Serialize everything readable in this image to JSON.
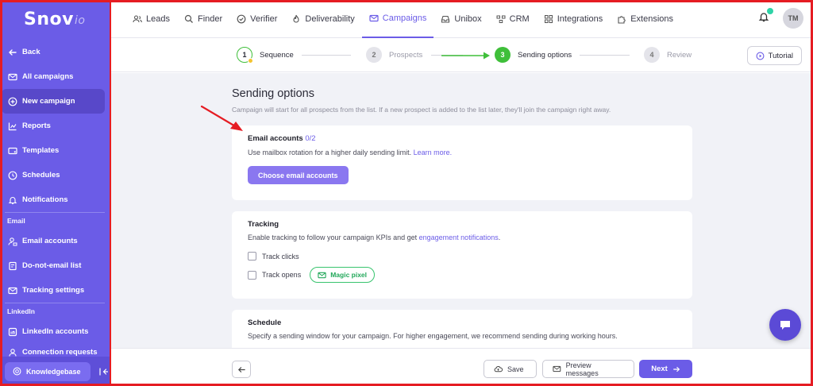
{
  "brand": {
    "name": "Snov",
    "suffix": "io"
  },
  "sidebar": {
    "items_top": [
      {
        "label": "Back",
        "icon": "arrow-left-icon"
      },
      {
        "label": "All campaigns",
        "icon": "mail-icon"
      },
      {
        "label": "New campaign",
        "icon": "plus-circle-icon",
        "active": true
      },
      {
        "label": "Reports",
        "icon": "chart-icon"
      },
      {
        "label": "Templates",
        "icon": "template-icon"
      },
      {
        "label": "Schedules",
        "icon": "clock-icon"
      },
      {
        "label": "Notifications",
        "icon": "bell-icon"
      }
    ],
    "section_email": "Email",
    "items_email": [
      {
        "label": "Email accounts",
        "icon": "accounts-icon"
      },
      {
        "label": "Do-not-email list",
        "icon": "block-list-icon"
      },
      {
        "label": "Tracking settings",
        "icon": "tracking-icon"
      }
    ],
    "section_linkedin": "LinkedIn",
    "items_linkedin": [
      {
        "label": "LinkedIn accounts",
        "icon": "linkedin-icon"
      },
      {
        "label": "Connection requests",
        "icon": "connection-icon"
      }
    ],
    "knowledgebase": "Knowledgebase"
  },
  "topnav": [
    {
      "label": "Leads",
      "icon": "leads-icon"
    },
    {
      "label": "Finder",
      "icon": "search-icon"
    },
    {
      "label": "Verifier",
      "icon": "check-circle-icon"
    },
    {
      "label": "Deliverability",
      "icon": "flame-icon"
    },
    {
      "label": "Campaigns",
      "icon": "mail-icon",
      "active": true
    },
    {
      "label": "Unibox",
      "icon": "inbox-icon"
    },
    {
      "label": "CRM",
      "icon": "crm-icon"
    },
    {
      "label": "Integrations",
      "icon": "grid-icon"
    },
    {
      "label": "Extensions",
      "icon": "puzzle-icon"
    }
  ],
  "user": {
    "initials": "TM"
  },
  "steps": [
    {
      "num": "1",
      "label": "Sequence",
      "state": "current"
    },
    {
      "num": "2",
      "label": "Prospects",
      "state": "inactive"
    },
    {
      "num": "3",
      "label": "Sending options",
      "state": "done"
    },
    {
      "num": "4",
      "label": "Review",
      "state": "inactive"
    }
  ],
  "tutorial_label": "Tutorial",
  "main": {
    "title": "Sending options",
    "subtitle": "Campaign will start for all prospects from the list. If a new prospect is added to the list later, they'll join the campaign right away.",
    "email_card": {
      "title": "Email accounts",
      "count": "0/2",
      "text": "Use mailbox rotation for a higher daily sending limit.",
      "link": "Learn more.",
      "button": "Choose email accounts"
    },
    "tracking_card": {
      "title": "Tracking",
      "text": "Enable tracking to follow your campaign KPIs and get",
      "link": "engagement notifications",
      "text_end": ".",
      "track_clicks": "Track clicks",
      "track_opens": "Track opens",
      "magic_pixel": "Magic pixel"
    },
    "schedule_card": {
      "title": "Schedule",
      "text": "Specify a sending window for your campaign. For higher engagement, we recommend sending during working hours."
    }
  },
  "bottom": {
    "save": "Save",
    "preview": "Preview messages",
    "next": "Next"
  },
  "colors": {
    "brand": "#6b5ce7",
    "success": "#3fbf3a",
    "annotation": "#e51c23"
  }
}
